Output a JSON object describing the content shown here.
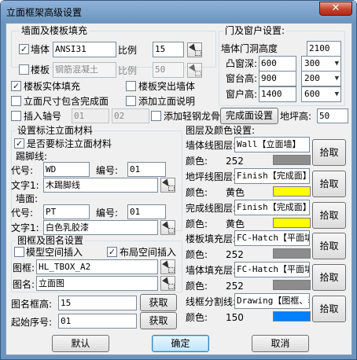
{
  "window": {
    "title": "立面框架高级设置",
    "close_glyph": "✕"
  },
  "wall_fill": {
    "title": "墙面及楼板填充",
    "wall": {
      "checked": true,
      "label": "墙体",
      "material": "ANSI31",
      "scale_label": "比例",
      "scale": "15"
    },
    "slab": {
      "checked": false,
      "label": "楼板",
      "material": "钢筋混凝土",
      "scale_label": "比例",
      "scale": "50"
    },
    "solid_fill": {
      "checked": true,
      "label": "楼板实体填充"
    },
    "protrude": {
      "checked": false,
      "label": "楼板突出墙体"
    },
    "incl_dims": {
      "checked": false,
      "label": "立面尺寸包含完成面"
    },
    "add_note": {
      "checked": false,
      "label": "添加立面说明"
    },
    "axis": {
      "checked": false,
      "label": "插入轴号",
      "from": "01",
      "to": "02"
    },
    "steel": {
      "checked": false,
      "label": "添加轻钢龙骨"
    },
    "finish_btn": "完成面设置",
    "floor_height_label": "地坪高:",
    "floor_height": "50"
  },
  "doors": {
    "title": "门及窗户设置:",
    "height_label": "墙体门洞高度",
    "height": "2100",
    "rows": [
      {
        "label": "凸窗深:",
        "value": "600",
        "select": "300"
      },
      {
        "label": "窗台高:",
        "value": "900",
        "select": "200"
      },
      {
        "label": "窗户高:",
        "value": "1400",
        "select": "600"
      }
    ]
  },
  "mat": {
    "title": "设置标注立面材料",
    "enable": {
      "checked": true,
      "label": "是否要标注立面材料"
    },
    "kick": {
      "title": "踢脚线:",
      "code_label": "代号:",
      "code": "WD",
      "num_label": "编号:",
      "num": "01",
      "text_label": "文字1:",
      "text": "木踢脚线"
    },
    "wall": {
      "title": "墙面:",
      "code_label": "代号:",
      "code": "PT",
      "num_label": "编号:",
      "num": "01",
      "text_label": "文字1:",
      "text": "白色乳胶漆"
    }
  },
  "frame": {
    "title": "图框及图名设置",
    "model": {
      "checked": false,
      "label": "模型空间插入"
    },
    "layout": {
      "checked": true,
      "label": "布局空间插入"
    },
    "frame_label": "图框:",
    "frame_value": "HL_TBOX_A2",
    "name_label": "图名:",
    "name_value": "立面图",
    "height_label": "图名框高:",
    "height_value": "15",
    "get1": "获取",
    "seq_label": "起始序号:",
    "seq_value": "01",
    "get2": "获取"
  },
  "layers": {
    "title": "图层及颜色设置:",
    "rows": [
      {
        "label": "墙体线图层:",
        "layer": "Wall【立面墙】",
        "color_label": "颜色:",
        "color_value": "252",
        "swatch": "#8c8c8c",
        "pick": "拾取"
      },
      {
        "label": "地坪线图层:",
        "layer": "Finish【完成面】",
        "color_label": "颜色:",
        "color_value": "黄色",
        "swatch": "#ffff00",
        "pick": "拾取"
      },
      {
        "label": "完成线图层:",
        "layer": "Finish【完成面】",
        "color_label": "颜色:",
        "color_value": "黄色",
        "swatch": "#ffff00",
        "pick": "拾取"
      },
      {
        "label": "楼板填充层:",
        "layer": "FC-Hatch【平面填充",
        "color_label": "颜色:",
        "color_value": "252",
        "swatch": "#8c8c8c",
        "pick": "拾取"
      },
      {
        "label": "墙体填充层:",
        "layer": "FC-Hatch【平面填充",
        "color_label": "颜色:",
        "color_value": "252",
        "swatch": "#8c8c8c",
        "pick": "拾取"
      },
      {
        "label": "线框分割线:",
        "layer": "Drawing【图框、表",
        "color_label": "颜色:",
        "color_value": "150",
        "swatch": "#007fff",
        "pick": "拾取"
      }
    ]
  },
  "footer": {
    "default": "默认",
    "ok": "确定",
    "cancel": "取消"
  }
}
